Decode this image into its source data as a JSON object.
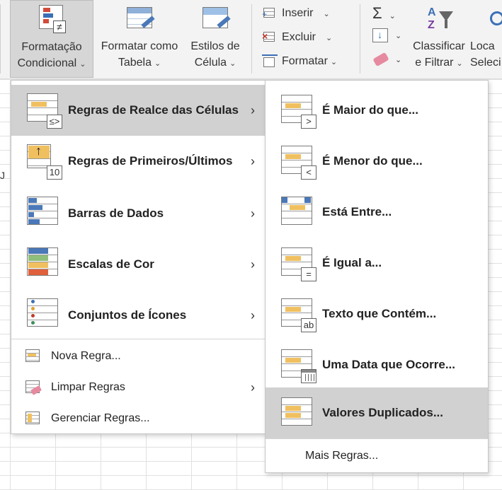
{
  "ribbon": {
    "conditional_formatting": [
      "Formatação",
      "Condicional"
    ],
    "format_as_table": [
      "Formatar como",
      "Tabela"
    ],
    "cell_styles": [
      "Estilos de",
      "Célula"
    ],
    "insert": "Inserir",
    "delete": "Excluir",
    "format": "Formatar",
    "sort_filter": [
      "Classificar",
      "e Filtrar"
    ],
    "find_select": [
      "Loca",
      "Seleci"
    ]
  },
  "sheet": {
    "column_header": "J"
  },
  "menu": {
    "items": [
      {
        "label": "Regras de Realce das Células",
        "has_submenu": true
      },
      {
        "label": "Regras de Primeiros/Últimos",
        "has_submenu": true
      },
      {
        "label": "Barras de Dados",
        "has_submenu": true
      },
      {
        "label": "Escalas de Cor",
        "has_submenu": true
      },
      {
        "label": "Conjuntos de Ícones",
        "has_submenu": true
      }
    ],
    "small_items": [
      {
        "label": "Nova Regra...",
        "has_submenu": false
      },
      {
        "label": "Limpar Regras",
        "has_submenu": true
      },
      {
        "label": "Gerenciar Regras...",
        "has_submenu": false
      }
    ],
    "icon_badges": {
      "highlight": "≤>",
      "top_bottom": "10"
    }
  },
  "submenu": {
    "items": [
      {
        "label": "É Maior do que...",
        "badge": ">"
      },
      {
        "label": "É Menor do que...",
        "badge": "<"
      },
      {
        "label": "Está Entre...",
        "badge": ""
      },
      {
        "label": "É Igual a...",
        "badge": "="
      },
      {
        "label": "Texto que Contém...",
        "badge": "ab"
      },
      {
        "label": "Uma Data que Ocorre...",
        "badge": ""
      },
      {
        "label": "Valores Duplicados...",
        "badge": ""
      }
    ],
    "more_rules": "Mais Regras..."
  },
  "colors": {
    "highlight": "#d1d1d1",
    "ribbon_bg": "#f3f3f3",
    "bar_yellow": "#f0c060",
    "bar_blue": "#4a78b8"
  }
}
